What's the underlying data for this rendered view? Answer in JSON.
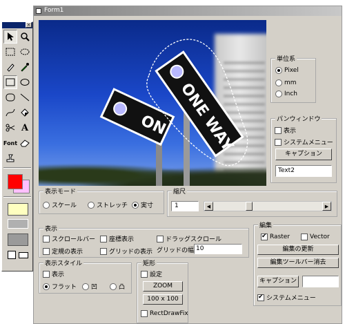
{
  "form": {
    "title": "Form1"
  },
  "photo": {
    "sign_text_1": "ONE WAY",
    "sign_text_2": "ON"
  },
  "units": {
    "label": "単位系",
    "options": [
      "Pixel",
      "mm",
      "Inch"
    ],
    "selected": "Pixel"
  },
  "pan": {
    "label": "パンウィンドウ",
    "show": "表示",
    "sysmenu": "システムメニュー",
    "caption_btn": "キャプション",
    "text": "Text2"
  },
  "display_mode": {
    "label": "表示モード",
    "options": [
      "スケール",
      "ストレッチ",
      "実寸"
    ],
    "selected": "実寸"
  },
  "zoom": {
    "label": "縮尺",
    "value": "1"
  },
  "display": {
    "label": "表示",
    "scrollbar": "スクロールバー",
    "coords": "座標表示",
    "drag": "ドラッグスクロール",
    "ruler": "定規の表示",
    "grid": "グリッドの表示",
    "grid_width_label": "グリッドの幅",
    "grid_width": "10"
  },
  "edit": {
    "label": "編集",
    "raster": "Raster",
    "vector": "Vector",
    "update_btn": "編集の更新",
    "clear_btn": "編集ツールバー消去",
    "caption_btn": "キャプション",
    "sysmenu": "システムメニュー"
  },
  "style": {
    "label": "表示スタイル",
    "show": "表示",
    "options": [
      "フラット",
      "凹",
      "凸"
    ],
    "selected": "フラット"
  },
  "rect": {
    "label": "矩形",
    "setting": "設定",
    "zoom_btn": "ZOOM",
    "size_btn": "100 x 100",
    "rectdraw": "RectDrawFix"
  },
  "palette": {
    "close": "×",
    "font_label": "Font",
    "text_tool": "A",
    "fore_color": "#ff0000",
    "back_color": "#ffc0ff",
    "swatch_color": "#ffffc0"
  },
  "colors": {
    "window_bg": "#d4d0c8",
    "title_grad_from": "#808080",
    "title_grad_to": "#c0c0c0"
  }
}
